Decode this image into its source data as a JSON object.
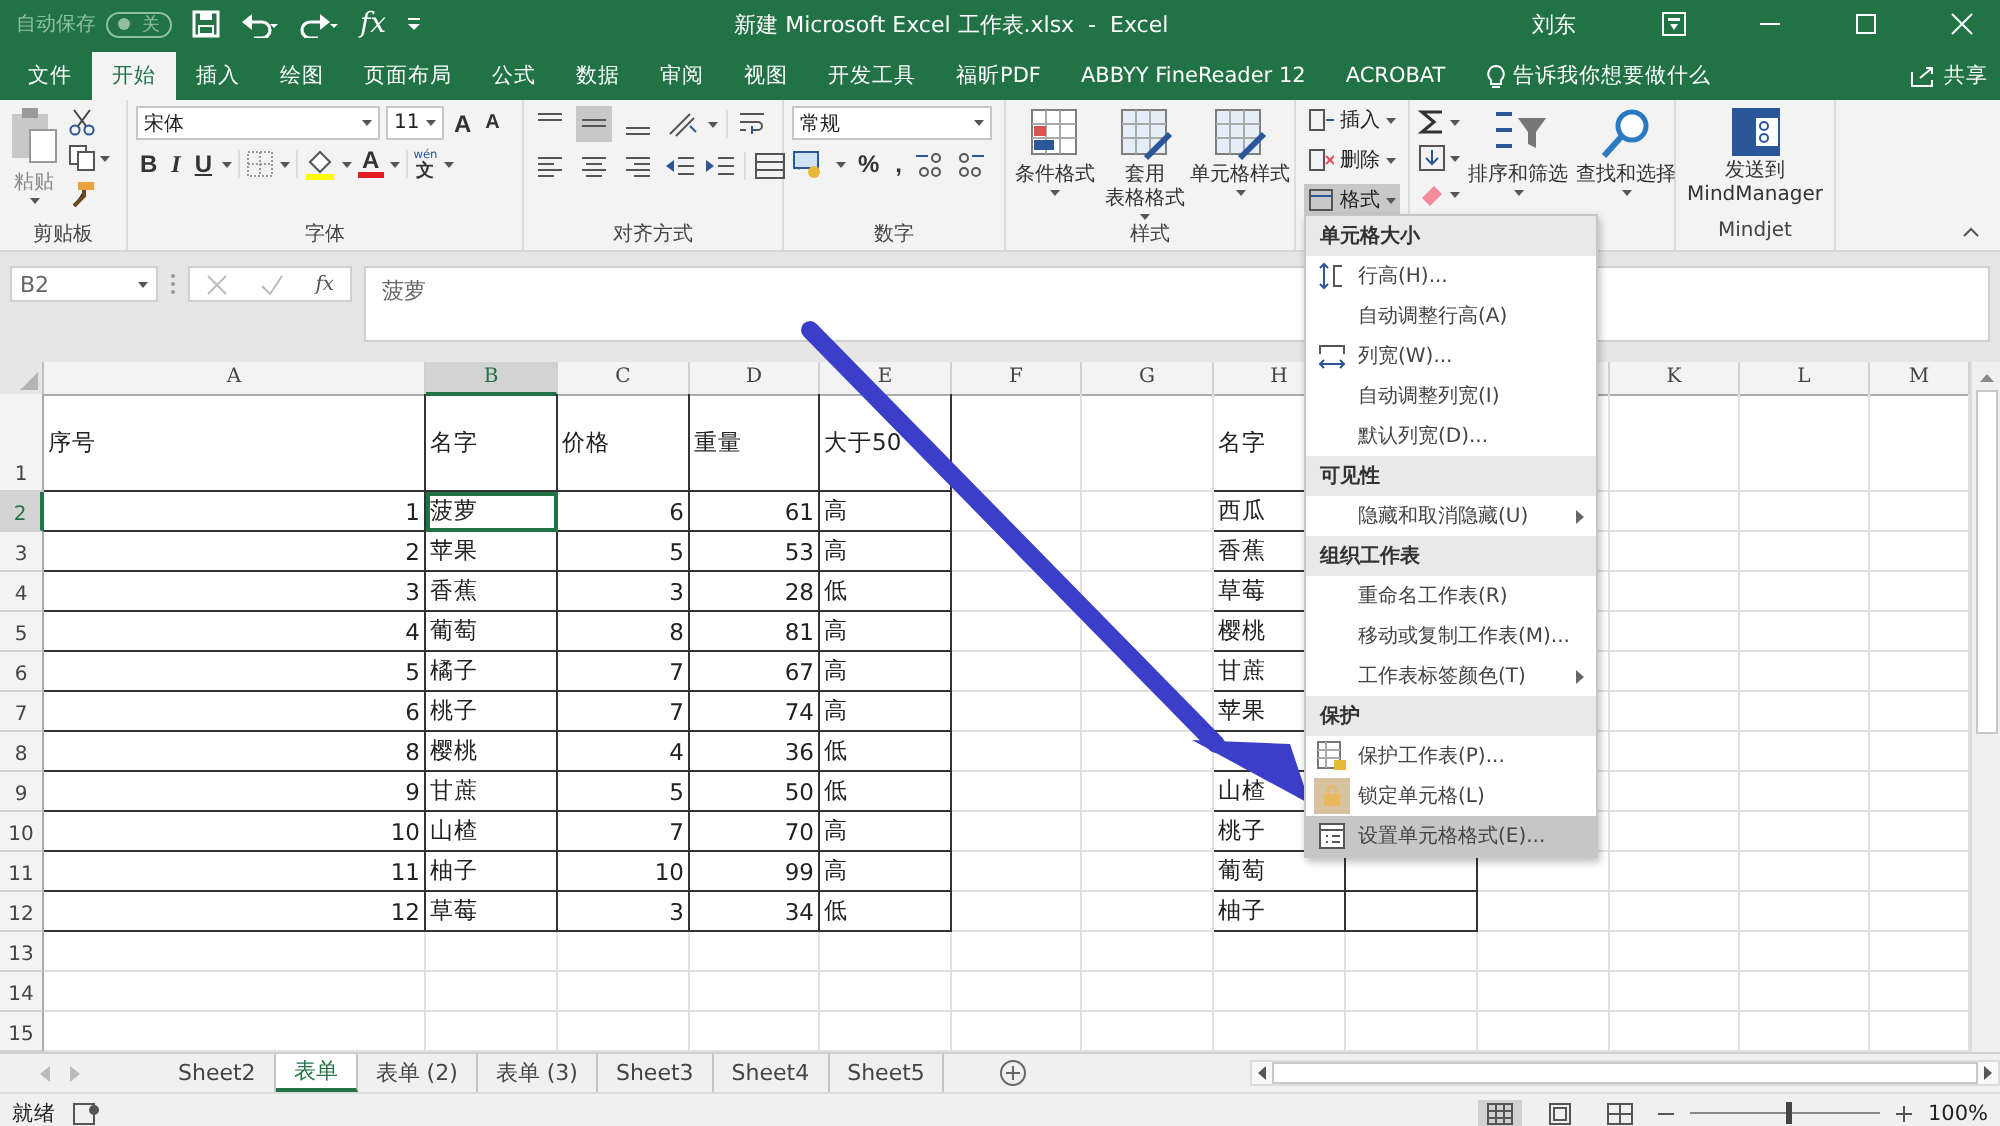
{
  "title_bar": {
    "autosave": {
      "label": "自动保存",
      "state_text": "关",
      "on": false
    },
    "function": "fx",
    "title": "新建 Microsoft Excel 工作表.xlsx  -  Excel",
    "user": "刘东"
  },
  "tabs": [
    {
      "label": "文件",
      "selected": false
    },
    {
      "label": "开始",
      "selected": true
    },
    {
      "label": "插入",
      "selected": false
    },
    {
      "label": "绘图",
      "selected": false
    },
    {
      "label": "页面布局",
      "selected": false
    },
    {
      "label": "公式",
      "selected": false
    },
    {
      "label": "数据",
      "selected": false
    },
    {
      "label": "审阅",
      "selected": false
    },
    {
      "label": "视图",
      "selected": false
    },
    {
      "label": "开发工具",
      "selected": false
    },
    {
      "label": "福昕PDF",
      "selected": false
    },
    {
      "label": "ABBYY FineReader 12",
      "selected": false
    },
    {
      "label": "ACROBAT",
      "selected": false
    }
  ],
  "tell_me": "告诉我你想要做什么",
  "share": "共享",
  "ribbon": {
    "clipboard": {
      "paste": "粘贴",
      "label": "剪贴板"
    },
    "font": {
      "name": "宋体",
      "size": "11",
      "grow": "A",
      "shrink": "A",
      "styles": [
        "B",
        "I",
        "U"
      ],
      "color_letter": "A",
      "phonetic_small": "wén",
      "phonetic": "文",
      "label": "字体"
    },
    "alignment": {
      "label": "对齐方式"
    },
    "number": {
      "format": "常规",
      "percent": "%",
      "comma": ",",
      "label": "数字"
    },
    "styles": {
      "buttons": [
        [
          "条件格式"
        ],
        [
          "套用",
          "表格格式"
        ],
        [
          "单元格样式"
        ]
      ],
      "label": "样式"
    },
    "cells": {
      "buttons": [
        {
          "label": "插入",
          "selected": false
        },
        {
          "label": "删除",
          "selected": false
        },
        {
          "label": "格式",
          "selected": true
        }
      ]
    },
    "editing": {
      "buttons": [
        "排序和筛选",
        "查找和选择"
      ]
    },
    "mindjet": {
      "button": [
        "发送到",
        "MindManager"
      ],
      "label": "Mindjet"
    }
  },
  "formula_bar": {
    "name_box": "B2",
    "function": "fx",
    "value": "菠萝"
  },
  "sheet": {
    "columns": [
      {
        "label": "A",
        "selected": false
      },
      {
        "label": "B",
        "selected": true
      },
      {
        "label": "C",
        "selected": false
      },
      {
        "label": "D",
        "selected": false
      },
      {
        "label": "E",
        "selected": false
      },
      {
        "label": "F",
        "selected": false
      },
      {
        "label": "G",
        "selected": false
      },
      {
        "label": "H",
        "selected": false
      },
      null,
      null,
      {
        "label": "K",
        "selected": false
      },
      {
        "label": "L",
        "selected": false
      },
      {
        "label": "M",
        "selected": false
      }
    ],
    "rows": [
      {
        "number": "1",
        "selected": false,
        "kind": "header",
        "cells": [
          "序号",
          "名字",
          "价格",
          "重量",
          "大于50",
          null,
          null,
          "名字"
        ]
      },
      {
        "number": "2",
        "selected": true,
        "kind": "data",
        "cells": [
          "1",
          "菠萝",
          "6",
          "61",
          "高",
          null,
          null,
          "西瓜"
        ]
      },
      {
        "number": "3",
        "selected": false,
        "kind": "data",
        "cells": [
          "2",
          "苹果",
          "5",
          "53",
          "高",
          null,
          null,
          "香蕉"
        ]
      },
      {
        "number": "4",
        "selected": false,
        "kind": "data",
        "cells": [
          "3",
          "香蕉",
          "3",
          "28",
          "低",
          null,
          null,
          "草莓"
        ]
      },
      {
        "number": "5",
        "selected": false,
        "kind": "data",
        "cells": [
          "4",
          "葡萄",
          "8",
          "81",
          "高",
          null,
          null,
          "樱桃"
        ]
      },
      {
        "number": "6",
        "selected": false,
        "kind": "data",
        "cells": [
          "5",
          "橘子",
          "7",
          "67",
          "高",
          null,
          null,
          "甘蔗"
        ]
      },
      {
        "number": "7",
        "selected": false,
        "kind": "data",
        "cells": [
          "6",
          "桃子",
          "7",
          "74",
          "高",
          null,
          null,
          "苹果"
        ]
      },
      {
        "number": "8",
        "selected": false,
        "kind": "data",
        "cells": [
          "8",
          "樱桃",
          "4",
          "36",
          "低"
        ]
      },
      {
        "number": "9",
        "selected": false,
        "kind": "data",
        "cells": [
          "9",
          "甘蔗",
          "5",
          "50",
          "低",
          null,
          null,
          "山楂"
        ]
      },
      {
        "number": "10",
        "selected": false,
        "kind": "data",
        "cells": [
          "10",
          "山楂",
          "7",
          "70",
          "高",
          null,
          null,
          "桃子"
        ]
      },
      {
        "number": "11",
        "selected": false,
        "kind": "data",
        "cells": [
          "11",
          "柚子",
          "10",
          "99",
          "高",
          null,
          null,
          "葡萄"
        ]
      },
      {
        "number": "12",
        "selected": false,
        "kind": "data",
        "cells": [
          "12",
          "草莓",
          "3",
          "34",
          "低",
          null,
          null,
          "柚子"
        ]
      },
      {
        "number": "13",
        "selected": false,
        "kind": "data"
      },
      {
        "number": "14",
        "selected": false,
        "kind": "data"
      },
      {
        "number": "15",
        "selected": false,
        "kind": "data"
      }
    ]
  },
  "context_menu": {
    "items": [
      {
        "kind": "header",
        "label": "单元格大小"
      },
      {
        "kind": "rowheight",
        "label": "行高(H)...",
        "selected": false
      },
      {
        "kind": "plain",
        "label": "自动调整行高(A)",
        "selected": false
      },
      {
        "kind": "colwidth",
        "label": "列宽(W)...",
        "selected": false
      },
      {
        "kind": "plain",
        "label": "自动调整列宽(I)",
        "selected": false
      },
      {
        "kind": "plain",
        "label": "默认列宽(D)...",
        "selected": false
      },
      {
        "kind": "header",
        "label": "可见性"
      },
      {
        "kind": "submenu",
        "label": "隐藏和取消隐藏(U)",
        "selected": false
      },
      {
        "kind": "header",
        "label": "组织工作表"
      },
      {
        "kind": "plain",
        "label": "重命名工作表(R)",
        "selected": false
      },
      {
        "kind": "plain",
        "label": "移动或复制工作表(M)...",
        "selected": false
      },
      {
        "kind": "submenu",
        "label": "工作表标签颜色(T)",
        "selected": false
      },
      {
        "kind": "header",
        "label": "保护"
      },
      {
        "kind": "protect",
        "label": "保护工作表(P)...",
        "selected": false
      },
      {
        "kind": "lock",
        "label": "锁定单元格(L)",
        "selected": false
      },
      {
        "kind": "format",
        "label": "设置单元格格式(E)...",
        "selected": true
      }
    ]
  },
  "sheet_tabs": [
    {
      "label": "Sheet2",
      "selected": false
    },
    {
      "label": "表单",
      "selected": true
    },
    {
      "label": "表单 (2)",
      "selected": false
    },
    {
      "label": "表单 (3)",
      "selected": false
    },
    {
      "label": "Sheet3",
      "selected": false
    },
    {
      "label": "Sheet4",
      "selected": false
    },
    {
      "label": "Sheet5",
      "selected": false
    }
  ],
  "status_bar": {
    "status": "就绪",
    "views": [
      {
        "selected": true
      },
      {
        "selected": false
      },
      {
        "selected": false
      }
    ],
    "zoom": {
      "level": 0.52
    },
    "zoom_text": "100%"
  }
}
